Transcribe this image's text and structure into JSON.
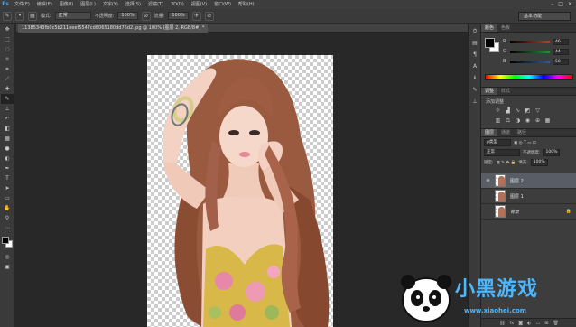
{
  "app": {
    "logo": "Ps"
  },
  "menu": [
    "文件(F)",
    "编辑(E)",
    "图像(I)",
    "图层(L)",
    "文字(Y)",
    "选择(S)",
    "滤镜(T)",
    "3D(D)",
    "视图(V)",
    "窗口(W)",
    "帮助(H)"
  ],
  "window_controls": [
    "–",
    "□",
    "✕"
  ],
  "options": {
    "mode_label": "模式:",
    "mode_value": "正常",
    "opacity_label": "不透明度:",
    "opacity_value": "100%",
    "flow_label": "流量:",
    "flow_value": "100%",
    "workspace": "基本功能"
  },
  "document": {
    "tab_label": "11385343fb0c5b211eeef5547cd8065180dd76d2.jpg @ 100% (图层 2, RGB/8#) *"
  },
  "color_panel": {
    "tabs": [
      "颜色",
      "色板"
    ],
    "sliders": [
      {
        "label": "R",
        "value": "46",
        "color": "#c0392b"
      },
      {
        "label": "G",
        "value": "44",
        "color": "#2e8b3a"
      },
      {
        "label": "B",
        "value": "58",
        "color": "#2c5aa0"
      }
    ]
  },
  "adjustments_panel": {
    "tabs": [
      "调整",
      "样式"
    ],
    "title": "添加调整"
  },
  "layers_panel": {
    "tabs": [
      "图层",
      "通道",
      "路径"
    ],
    "kind_label": "ρ类型",
    "blend_mode": "正常",
    "opacity_label": "不透明度:",
    "opacity_value": "100%",
    "lock_label": "锁定:",
    "fill_label": "填充:",
    "fill_value": "100%",
    "layers": [
      {
        "name": "图层 2",
        "selected": true,
        "visible": true,
        "locked": false
      },
      {
        "name": "图层 1",
        "selected": false,
        "visible": false,
        "locked": false
      },
      {
        "name": "背景",
        "selected": false,
        "visible": false,
        "locked": true
      }
    ]
  },
  "watermark": {
    "brand": "小黑游戏",
    "url": "www.xiaohei.com"
  }
}
